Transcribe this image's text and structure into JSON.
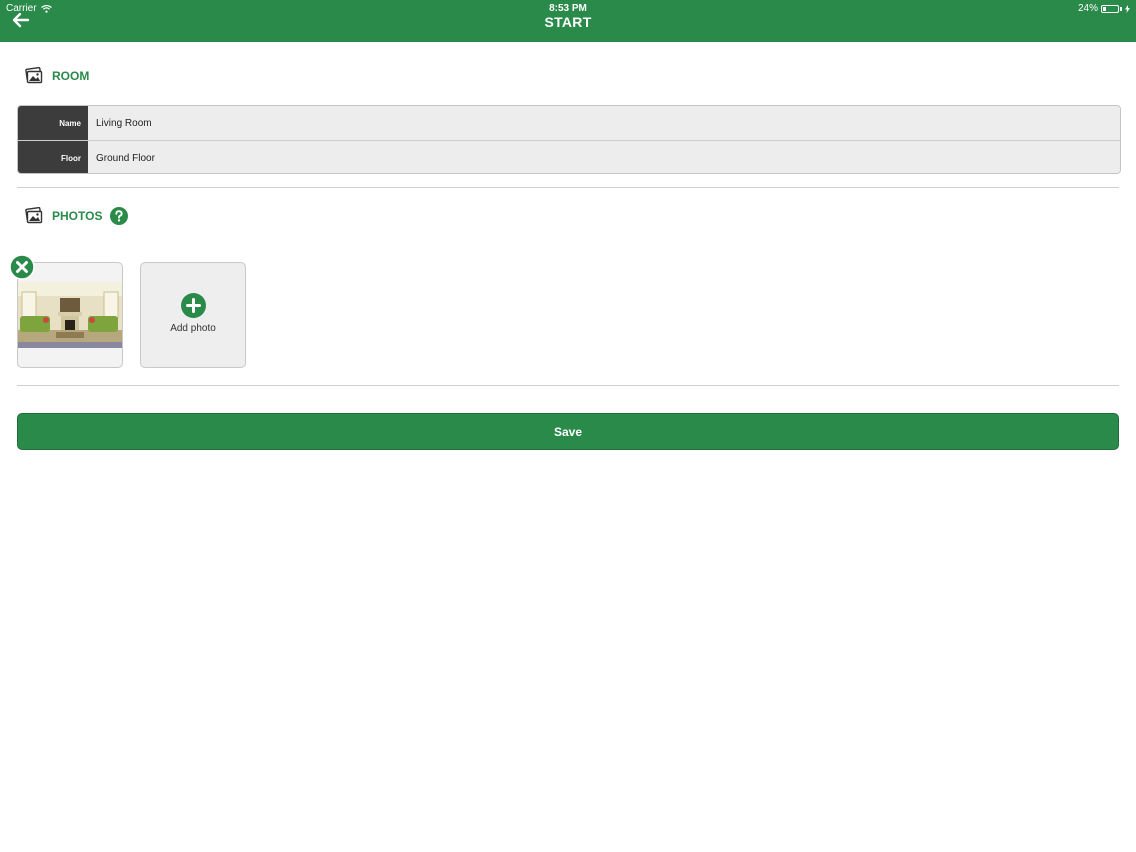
{
  "status_bar": {
    "carrier": "Carrier",
    "time": "8:53 PM",
    "battery": "24%",
    "battery_level": 0.24
  },
  "header": {
    "title": "START",
    "back_icon": "arrow-left-icon"
  },
  "room_section": {
    "title": "ROOM",
    "icon": "photos-stack-icon",
    "fields": [
      {
        "label": "Name",
        "value": "Living Room"
      },
      {
        "label": "Floor",
        "value": "Ground Floor"
      }
    ]
  },
  "photos_section": {
    "title": "PHOTOS",
    "icon": "photos-stack-icon",
    "help_icon": "help-icon",
    "remove_icon": "close-icon",
    "add_label": "Add photo",
    "add_icon": "plus-icon"
  },
  "actions": {
    "save_label": "Save"
  },
  "colors": {
    "brand_green": "#2a8a4a",
    "label_dark": "#3c3c3c"
  }
}
